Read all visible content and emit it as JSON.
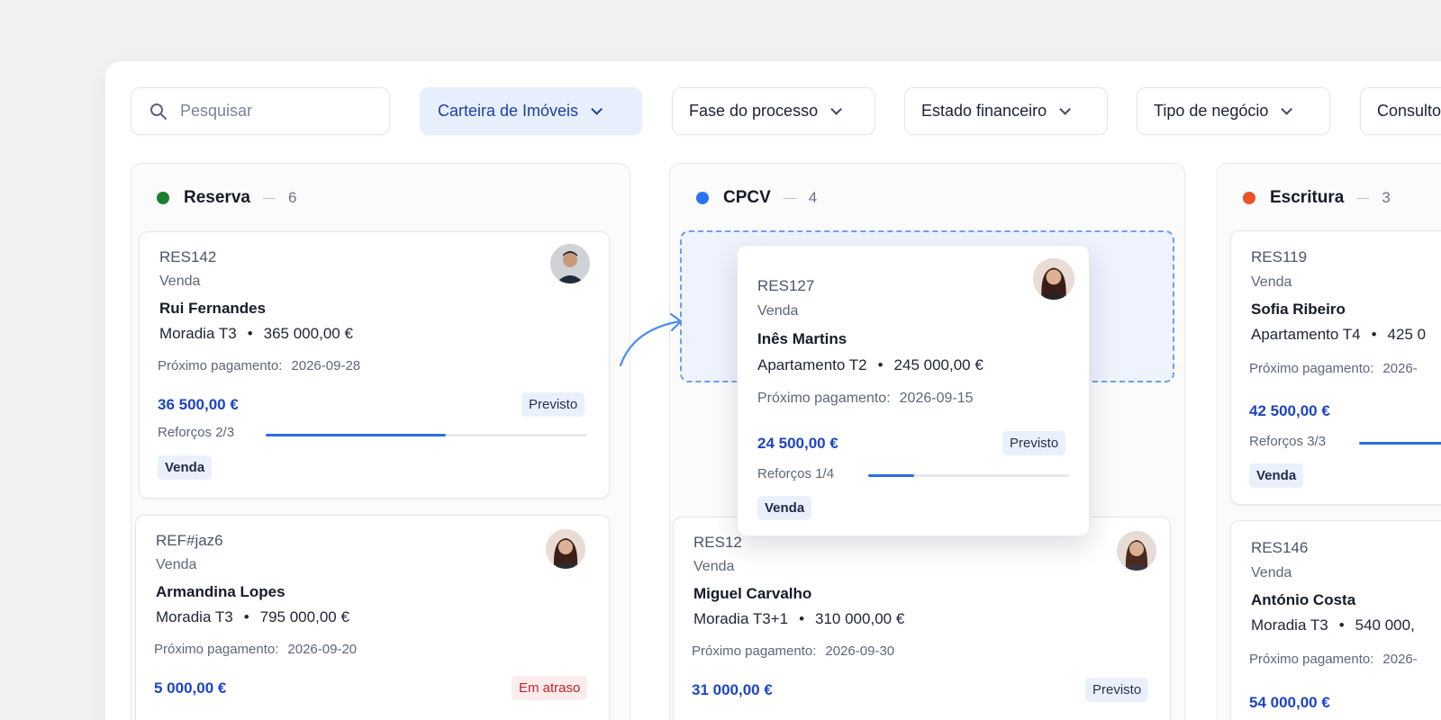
{
  "filters": {
    "search_placeholder": "Pesquisar",
    "items": [
      "Carteira de Imóveis",
      "Fase do processo",
      "Estado financeiro",
      "Tipo de negócio",
      "Consulto"
    ]
  },
  "colors": {
    "reserva": "#1a7f2e",
    "cpcv": "#2b74f0",
    "escritura": "#e8532a",
    "accent": "#1d44c4"
  },
  "columns": [
    {
      "title": "Reserva",
      "count": "6",
      "cards": [
        {
          "ref": "RES142",
          "kind": "Venda",
          "name": "Rui Fernandes",
          "prop": "Moradia T3",
          "price": "365 000,00 €",
          "pay_label": "Próximo pagamento:",
          "pay_date": "2026-09-28",
          "amount": "36 500,00 €",
          "status": "Previsto",
          "reforcos": "Reforços 2/3",
          "progress": 0.56,
          "tag": "Venda"
        },
        {
          "ref": "REF#jaz6",
          "kind": "Venda",
          "name": "Armandina Lopes",
          "prop": "Moradia T3",
          "price": "795 000,00 €",
          "pay_label": "Próximo pagamento:",
          "pay_date": "2026-09-20",
          "amount": "5 000,00 €",
          "status": "Em atraso"
        }
      ]
    },
    {
      "title": "CPCV",
      "count": "4",
      "cards": [
        {
          "ref": "RES127",
          "kind": "Venda",
          "name": "Inês Martins",
          "prop": "Apartamento T2",
          "price": "245 000,00 €",
          "pay_label": "Próximo pagamento:",
          "pay_date": "2026-09-15",
          "amount": "24 500,00 €",
          "status": "Previsto",
          "reforcos": "Reforços 1/4",
          "progress": 0.23,
          "tag": "Venda"
        },
        {
          "ref": "RES12",
          "kind": "Venda",
          "name": "Miguel Carvalho",
          "prop": "Moradia T3+1",
          "price": "310 000,00 €",
          "pay_label": "Próximo pagamento:",
          "pay_date": "2026-09-30",
          "amount": "31 000,00 €",
          "status": "Previsto"
        }
      ]
    },
    {
      "title": "Escritura",
      "count": "3",
      "cards": [
        {
          "ref": "RES119",
          "kind": "Venda",
          "name": "Sofia Ribeiro",
          "prop": "Apartamento T4",
          "price": "425 0",
          "pay_label": "Próximo pagamento:",
          "pay_date": "2026-",
          "amount": "42 500,00 €",
          "reforcos": "Reforços 3/3",
          "tag": "Venda"
        },
        {
          "ref": "RES146",
          "kind": "Venda",
          "name": "António Costa",
          "prop": "Moradia T3",
          "price": "540 000,",
          "pay_label": "Próximo pagamento:",
          "pay_date": "2026-",
          "amount": "54 000,00 €"
        }
      ]
    }
  ]
}
